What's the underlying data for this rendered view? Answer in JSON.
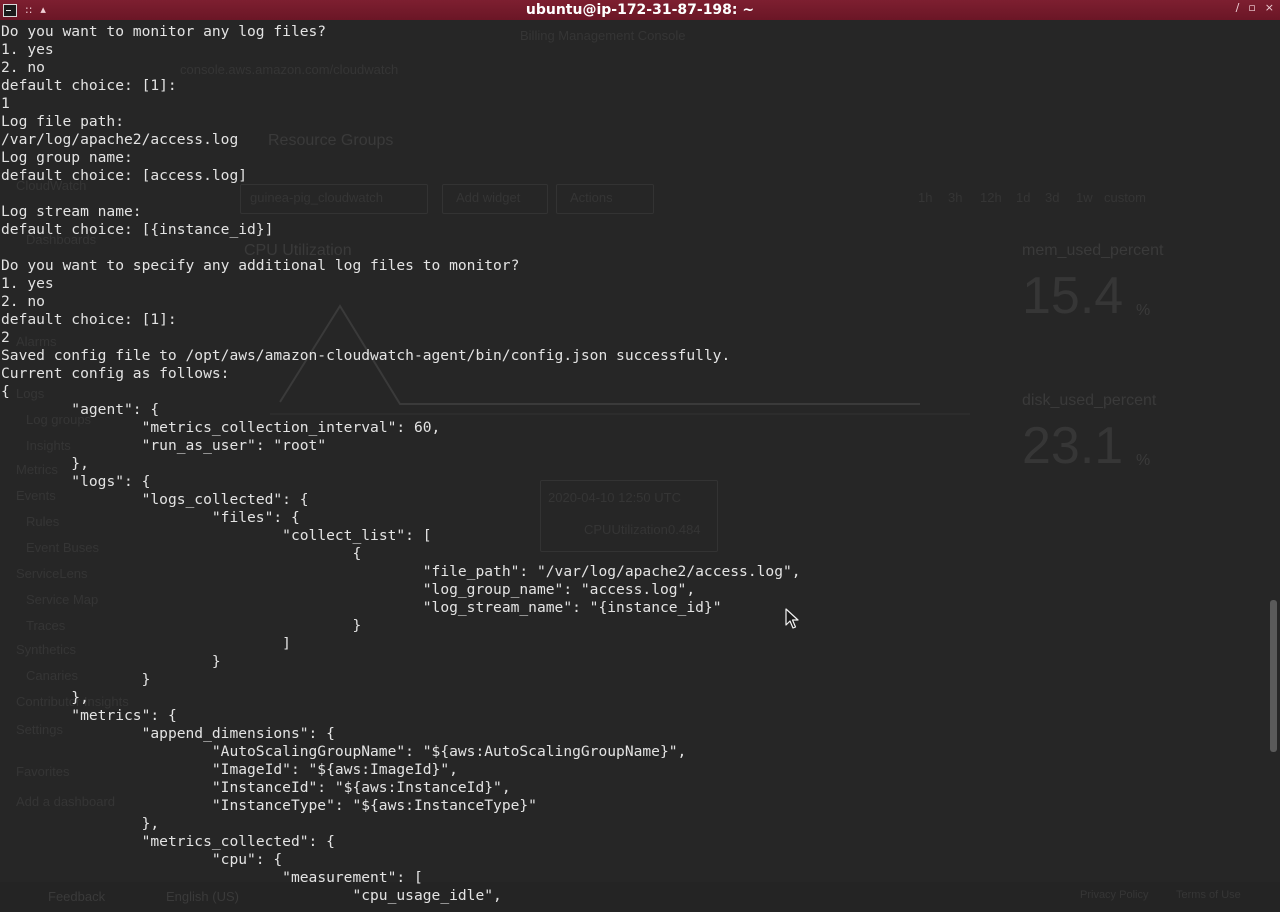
{
  "window": {
    "title": "ubuntu@ip-172-31-87-198: ~",
    "menu_glyph": "::",
    "pin_glyph": "▴",
    "minimize_glyph": "∕",
    "maximize_glyph": "▫",
    "close_glyph": "×"
  },
  "colors": {
    "titlebar": "#6b1626",
    "terminal_bg": "#262626",
    "terminal_fg": "#e3e3e3"
  },
  "terminal": {
    "lines": [
      "Do you want to monitor any log files?",
      "1. yes",
      "2. no",
      "default choice: [1]:",
      "1",
      "Log file path:",
      "/var/log/apache2/access.log",
      "Log group name:",
      "default choice: [access.log]",
      "",
      "Log stream name:",
      "default choice: [{instance_id}]",
      "",
      "Do you want to specify any additional log files to monitor?",
      "1. yes",
      "2. no",
      "default choice: [1]:",
      "2",
      "Saved config file to /opt/aws/amazon-cloudwatch-agent/bin/config.json successfully.",
      "Current config as follows:",
      "{",
      "\t\"agent\": {",
      "\t\t\"metrics_collection_interval\": 60,",
      "\t\t\"run_as_user\": \"root\"",
      "\t},",
      "\t\"logs\": {",
      "\t\t\"logs_collected\": {",
      "\t\t\t\"files\": {",
      "\t\t\t\t\"collect_list\": [",
      "\t\t\t\t\t{",
      "\t\t\t\t\t\t\"file_path\": \"/var/log/apache2/access.log\",",
      "\t\t\t\t\t\t\"log_group_name\": \"access.log\",",
      "\t\t\t\t\t\t\"log_stream_name\": \"{instance_id}\"",
      "\t\t\t\t\t}",
      "\t\t\t\t]",
      "\t\t\t}",
      "\t\t}",
      "\t},",
      "\t\"metrics\": {",
      "\t\t\"append_dimensions\": {",
      "\t\t\t\"AutoScalingGroupName\": \"${aws:AutoScalingGroupName}\",",
      "\t\t\t\"ImageId\": \"${aws:ImageId}\",",
      "\t\t\t\"InstanceId\": \"${aws:InstanceId}\",",
      "\t\t\t\"InstanceType\": \"${aws:InstanceType}\"",
      "\t\t},",
      "\t\t\"metrics_collected\": {",
      "\t\t\t\"cpu\": {",
      "\t\t\t\t\"measurement\": [",
      "\t\t\t\t\t\"cpu_usage_idle\","
    ]
  },
  "ghost": {
    "tab_title": "Billing Management Console",
    "address": "console.aws.amazon.com/cloudwatch",
    "resource_groups": "Resource Groups",
    "dashboard_select": "guinea-pig_cloudwatch",
    "add_widget": "Add widget",
    "actions": "Actions",
    "time_ranges": [
      "1h",
      "3h",
      "12h",
      "1d",
      "3d",
      "1w",
      "custom"
    ],
    "widget_title": "CPU Utilization",
    "mem_label": "mem_used_percent",
    "mem_value": "15.4",
    "mem_unit": "%",
    "disk_label": "disk_used_percent",
    "disk_value": "23.1",
    "disk_unit": "%",
    "tooltip_time": "2020-04-10 12:50 UTC",
    "tooltip_series": "CPUUtilization",
    "tooltip_value": "0.484",
    "nav": [
      "CloudWatch",
      "Dashboards",
      "Alarms",
      "Logs",
      "Log groups",
      "Insights",
      "Metrics",
      "Events",
      "Rules",
      "Event Buses",
      "ServiceLens",
      "Service Map",
      "Traces",
      "Synthetics",
      "Canaries",
      "Contributor Insights",
      "Settings",
      "Favorites",
      "Add a dashboard"
    ],
    "footer": [
      "Feedback",
      "English (US)",
      "Privacy Policy",
      "Terms of Use"
    ]
  }
}
